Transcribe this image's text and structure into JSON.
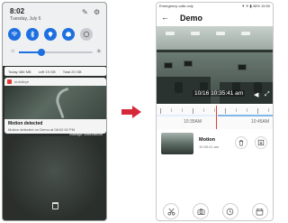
{
  "left_phone": {
    "shade": {
      "time": "8:02",
      "date": "Tuesday, July 6",
      "quick_settings": [
        {
          "icon": "wifi-icon",
          "on": true
        },
        {
          "icon": "bluetooth-icon",
          "on": true
        },
        {
          "icon": "location-icon",
          "on": true
        },
        {
          "icon": "bell-icon",
          "on": true
        },
        {
          "icon": "data-icon",
          "on": false
        }
      ],
      "brightness_level": 0.3
    },
    "usage": {
      "today": "Today 486 MB",
      "left": "Left 19 GB",
      "total": "Total 20 GB"
    },
    "notification": {
      "app_name": "mobileye",
      "title": "Motion detected",
      "subtitle": "Motion detected on Demo at 08:02:52 PM",
      "manage_label": "Manage notifications"
    }
  },
  "right_phone": {
    "status": {
      "left": "Emergency calls only",
      "right": "⁕ ✈ ▮ 38% 10:50"
    },
    "app_bar": {
      "back_icon": "arrow-back-icon",
      "title": "Demo"
    },
    "video": {
      "timestamp": "10/16 10:35:41 am"
    },
    "timeline": {
      "labels": [
        "10:35AM",
        "10:45AM"
      ]
    },
    "event": {
      "title": "Motion",
      "time": "10:35:41 am"
    },
    "bottom_actions": [
      {
        "icon": "scissors-icon"
      },
      {
        "icon": "camera-icon"
      },
      {
        "icon": "clock-icon"
      },
      {
        "icon": "calendar-icon"
      }
    ]
  },
  "arrow_color": "#d6283a"
}
